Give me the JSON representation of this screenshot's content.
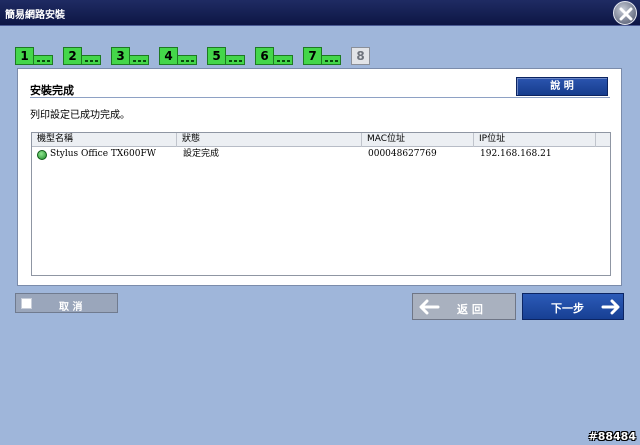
{
  "window": {
    "title": "簡易網路安裝"
  },
  "steps": [
    {
      "label": "1",
      "state": "done"
    },
    {
      "label": "2",
      "state": "done"
    },
    {
      "label": "3",
      "state": "done"
    },
    {
      "label": "4",
      "state": "done"
    },
    {
      "label": "5",
      "state": "done"
    },
    {
      "label": "6",
      "state": "done"
    },
    {
      "label": "7",
      "state": "done"
    },
    {
      "label": "8",
      "state": "current"
    }
  ],
  "panel": {
    "title": "安裝完成",
    "help_label": "說 明",
    "message": "列印設定已成功完成。"
  },
  "table": {
    "columns": [
      "機型名稱",
      "狀態",
      "MAC位址",
      "IP位址"
    ],
    "rows": [
      {
        "model": "Stylus Office TX600FW",
        "status": "設定完成",
        "mac": "000048627769",
        "ip": "192.168.168.21",
        "status_icon": "ok-icon"
      }
    ]
  },
  "buttons": {
    "cancel": "取 消",
    "back": "返 回",
    "next": "下一步"
  },
  "watermark": "#88484",
  "colors": {
    "titlebar": "#0d1644",
    "background": "#9fb6da",
    "step_done": "#44d64a",
    "step_current": "#e2e4e8",
    "primary_button": "#1f4aa3"
  }
}
